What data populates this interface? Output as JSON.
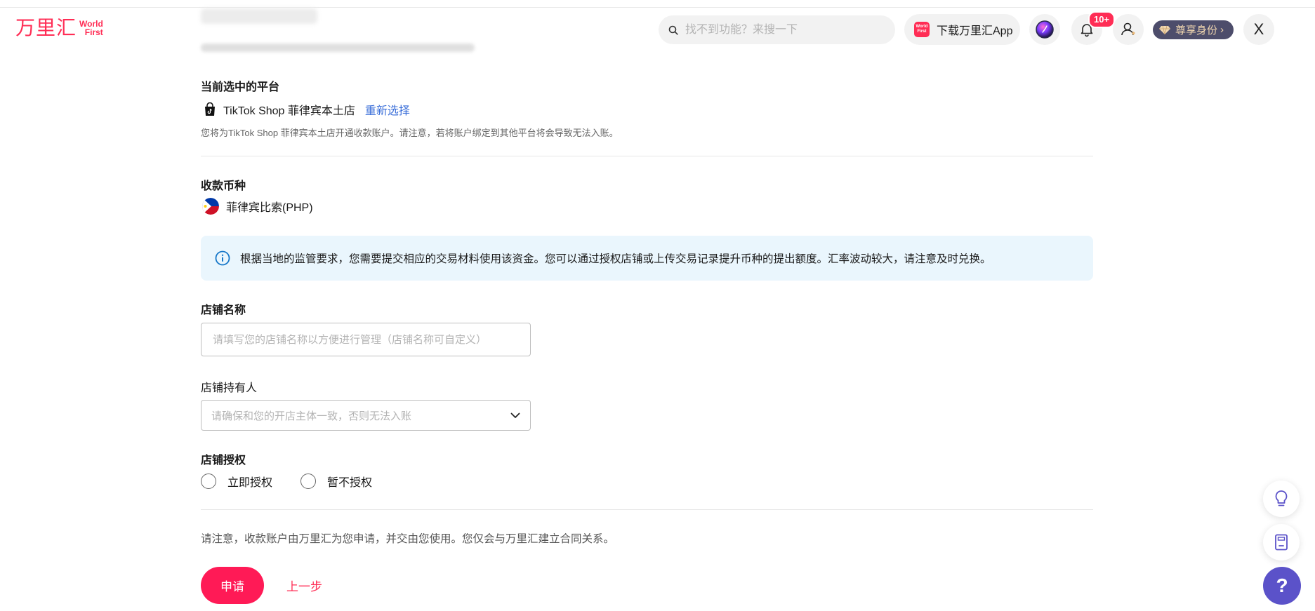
{
  "header": {
    "logo_cn": "万里汇",
    "logo_en_line1": "World",
    "logo_en_line2": "First",
    "search_placeholder": "找不到功能？来搜一下",
    "download_app_label": "下载万里汇App",
    "app_icon_line1": "World",
    "app_icon_line2": "First",
    "notification_badge": "10+",
    "vip_label": "尊享身份",
    "vip_chevron": "›",
    "close_symbol": "X"
  },
  "platform": {
    "title": "当前选中的平台",
    "shop_name": "TikTok Shop 菲律宾本土店",
    "reselect_label": "重新选择",
    "note": "您将为TikTok Shop 菲律宾本土店开通收款账户。请注意，若将账户绑定到其他平台将会导致无法入账。"
  },
  "currency": {
    "title": "收款币种",
    "name": "菲律宾比索(PHP)"
  },
  "info": {
    "text": "根据当地的监管要求，您需要提交相应的交易材料使用该资金。您可以通过授权店铺或上传交易记录提升币种的提出额度。汇率波动较大，请注意及时兑换。"
  },
  "form": {
    "store_name_label": "店铺名称",
    "store_name_placeholder": "请填写您的店铺名称以方便进行管理（店铺名称可自定义）",
    "store_holder_label": "店铺持有人",
    "store_holder_placeholder": "请确保和您的开店主体一致，否则无法入账",
    "auth_label": "店铺授权",
    "auth_options": [
      "立即授权",
      "暂不授权"
    ]
  },
  "footer": {
    "note": "请注意，收款账户由万里汇为您申请，并交由您使用。您仅会与万里汇建立合同关系。",
    "submit_label": "申请",
    "back_label": "上一步"
  },
  "floating": {
    "help_symbol": "?"
  },
  "colors": {
    "brand": "#ff2d55",
    "link": "#3b6fd9",
    "info_bg": "#eaf6fd",
    "help_btn": "#5b52c9"
  }
}
